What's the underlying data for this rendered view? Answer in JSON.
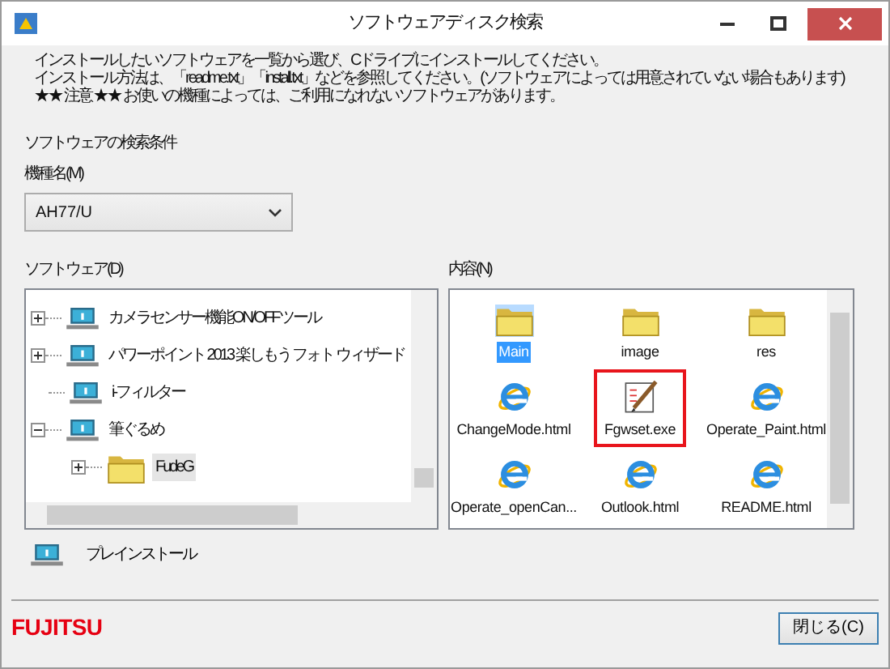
{
  "window": {
    "title": "ソフトウェアディスク検索"
  },
  "instructions": [
    "インストールしたいソフトウェアを一覧から選び、Cドライブにインストールしてください。",
    "インストール方法は、「readme.txt」「install.txt」などを参照してください。(ソフトウェアによっては用意されていない場合もあります)",
    "★★ 注意 ★★ お使いの機種によっては、ご利用になれないソフトウェアがあります。"
  ],
  "search_conditions": {
    "heading": "ソフトウェアの検索条件",
    "model_label": "機種名(M)",
    "model_value": "AH77/U"
  },
  "software": {
    "label": "ソフトウェア(D)",
    "tree": [
      {
        "label": "カメラセンサー機能ON/OFFツール",
        "kind": "app",
        "expanded": false,
        "selected": false
      },
      {
        "label": "パワーポイント 2013 楽しもう フォト ウィザード",
        "kind": "app",
        "expanded": false,
        "selected": false
      },
      {
        "label": "i-フィルター",
        "kind": "app",
        "selected": false
      },
      {
        "label": "筆ぐるめ",
        "kind": "app",
        "expanded": true,
        "selected": false,
        "children": [
          {
            "label": "FudeG",
            "kind": "folder",
            "expanded": false,
            "selected": true
          }
        ]
      }
    ]
  },
  "contents": {
    "label": "内容(N)",
    "items": [
      {
        "name": "Main",
        "kind": "folder",
        "selected": true,
        "marked": false
      },
      {
        "name": "image",
        "kind": "folder",
        "selected": false,
        "marked": false
      },
      {
        "name": "res",
        "kind": "folder",
        "selected": false,
        "marked": false
      },
      {
        "name": "ChangeMode.html",
        "kind": "html",
        "selected": false,
        "marked": false
      },
      {
        "name": "Fgwset.exe",
        "kind": "exe",
        "selected": false,
        "marked": true
      },
      {
        "name": "Operate_Paint.html",
        "kind": "html",
        "selected": false,
        "marked": false
      },
      {
        "name": "Operate_openCan...",
        "kind": "html",
        "selected": false,
        "marked": false
      },
      {
        "name": "Outlook.html",
        "kind": "html",
        "selected": false,
        "marked": false
      },
      {
        "name": "README.html",
        "kind": "html",
        "selected": false,
        "marked": false
      }
    ]
  },
  "install_button": {
    "label": "プレインストール"
  },
  "footer": {
    "logo": "FUJITSU",
    "close_button": "閉じる(C)"
  }
}
